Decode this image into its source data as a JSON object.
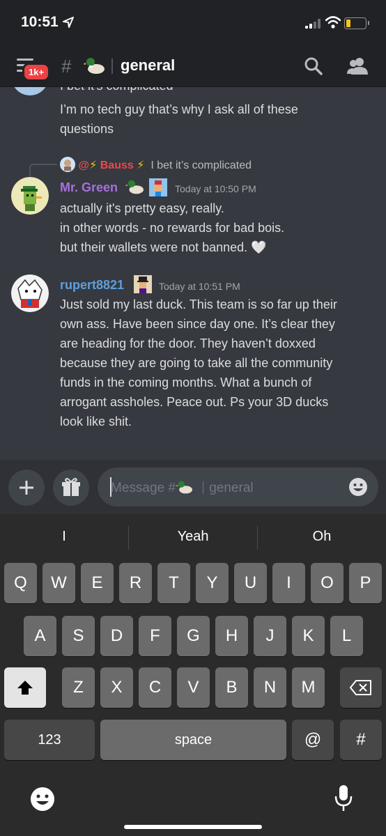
{
  "status": {
    "time": "10:51"
  },
  "header": {
    "badge": "1k+",
    "channel": "general"
  },
  "messages": {
    "prev_line_cut": "I bet it's complicated",
    "prev_lines": [
      "I’m no tech guy that’s why I ask all of these",
      "questions"
    ],
    "reply": {
      "at": "@",
      "bolt": "⚡",
      "user": "Bauss",
      "text": "I bet it’s complicated"
    },
    "m1": {
      "user": "Mr. Green",
      "timestamp": "Today at 10:50 PM",
      "lines": [
        "actually it's pretty easy, really.",
        "in other words - no rewards for bad bois.",
        "but their wallets were not banned. 🤍"
      ]
    },
    "m2": {
      "user": "rupert8821",
      "timestamp": "Today at 10:51 PM",
      "lines": [
        "Just sold my last duck. This team is so far up their",
        "own ass. Have been since day one. It’s clear they",
        "are heading for the door. They haven’t doxxed",
        "because they are going to take all the community",
        "funds in the coming months. What a bunch of",
        "arrogant assholes. Peace out. Ps your 3D ducks",
        "look like shit."
      ]
    }
  },
  "composer": {
    "placeholder_prefix": "Message #",
    "placeholder_channel": "general"
  },
  "keyboard": {
    "suggestions": [
      "I",
      "Yeah",
      "Oh"
    ],
    "row1": [
      "Q",
      "W",
      "E",
      "R",
      "T",
      "Y",
      "U",
      "I",
      "O",
      "P"
    ],
    "row2": [
      "A",
      "S",
      "D",
      "F",
      "G",
      "H",
      "J",
      "K",
      "L"
    ],
    "row3": [
      "Z",
      "X",
      "C",
      "V",
      "B",
      "N",
      "M"
    ],
    "numbers": "123",
    "space": "space",
    "at": "@",
    "hash": "#"
  },
  "colors": {
    "mr_green": "#a86ee2",
    "rupert": "#5d9fe0",
    "mention": "#f04747",
    "background": "#36393f"
  }
}
